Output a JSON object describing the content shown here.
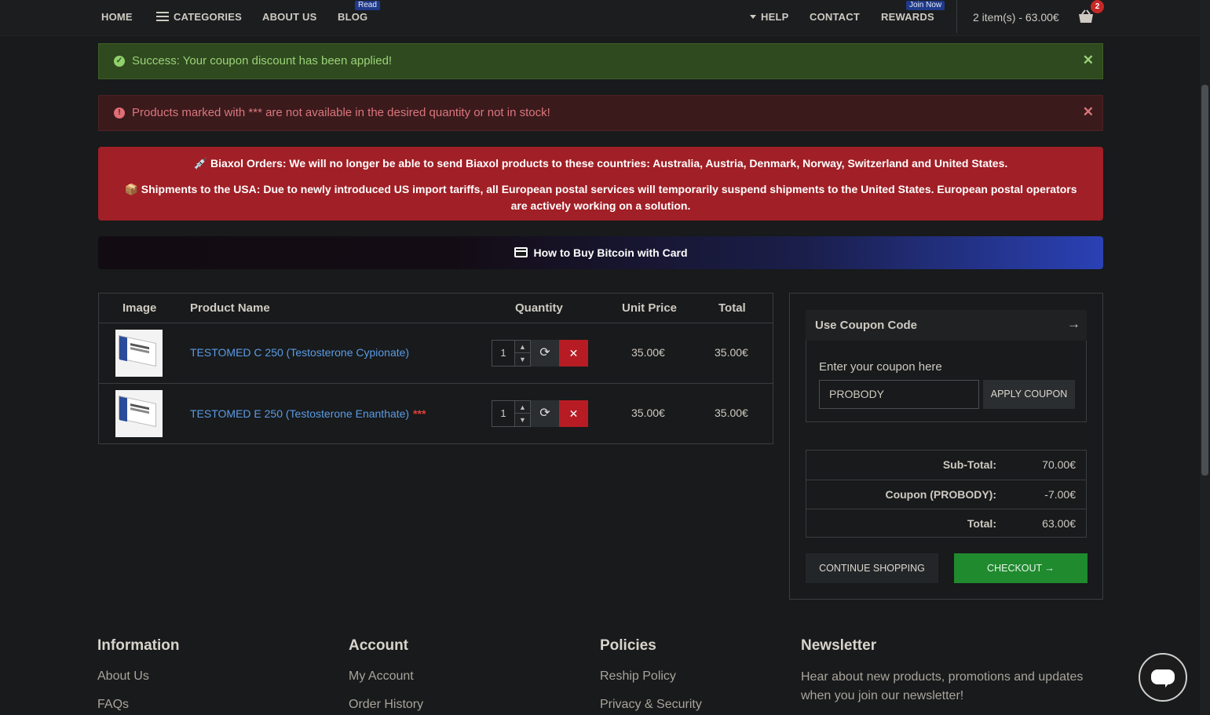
{
  "nav": {
    "home": "HOME",
    "categories": "CATEGORIES",
    "about": "ABOUT US",
    "blog": "BLOG",
    "blog_badge": "Read",
    "help": "HELP",
    "contact": "CONTACT",
    "rewards": "REWARDS",
    "rewards_badge": "Join Now",
    "cart_summary": "2 item(s) - 63.00€",
    "cart_count": "2"
  },
  "alerts": {
    "success": "Success: Your coupon discount has been applied!",
    "danger": "Products marked with *** are not available in the desired quantity or not in stock!"
  },
  "notice": {
    "line1": "💉 Biaxol Orders: We will no longer be able to send Biaxol products to these countries: Australia, Austria, Denmark, Norway, Switzerland and United States.",
    "line2": "📦 Shipments to the USA: Due to newly introduced US import tariffs, all European postal services will temporarily suspend shipments to the United States. European postal operators are actively working on a solution."
  },
  "banner": "How to Buy Bitcoin with Card",
  "cart": {
    "headers": [
      "Image",
      "Product Name",
      "Quantity",
      "Unit Price",
      "Total"
    ],
    "items": [
      {
        "name": "TESTOMED C 250 (Testosterone Cypionate)",
        "stars": "",
        "qty": "1",
        "unit_price": "35.00€",
        "total": "35.00€"
      },
      {
        "name": "TESTOMED E 250 (Testosterone Enanthate)",
        "stars": "***",
        "qty": "1",
        "unit_price": "35.00€",
        "total": "35.00€"
      }
    ]
  },
  "coupon": {
    "title": "Use Coupon Code",
    "label": "Enter your coupon here",
    "value": "PROBODY",
    "apply": "APPLY COUPON"
  },
  "totals": [
    {
      "label": "Sub-Total:",
      "value": "70.00€"
    },
    {
      "label": "Coupon (PROBODY):",
      "value": "-7.00€"
    },
    {
      "label": "Total:",
      "value": "63.00€"
    }
  ],
  "buttons": {
    "continue": "CONTINUE SHOPPING",
    "checkout": "CHECKOUT →"
  },
  "footer": {
    "information": {
      "title": "Information",
      "links": [
        "About Us",
        "FAQs"
      ]
    },
    "account": {
      "title": "Account",
      "links": [
        "My Account",
        "Order History"
      ]
    },
    "policies": {
      "title": "Policies",
      "links": [
        "Reship Policy",
        "Privacy & Security"
      ]
    },
    "newsletter": {
      "title": "Newsletter",
      "text": "Hear about new products, promotions and updates when you join our newsletter!"
    }
  },
  "colors": {
    "background": "#181a1b",
    "success": "#2f4a1e",
    "danger": "#3b1a1c",
    "notice": "#a11f26",
    "link": "#5b9be6",
    "checkout": "#1f8a2e",
    "remove": "#b71c24"
  }
}
